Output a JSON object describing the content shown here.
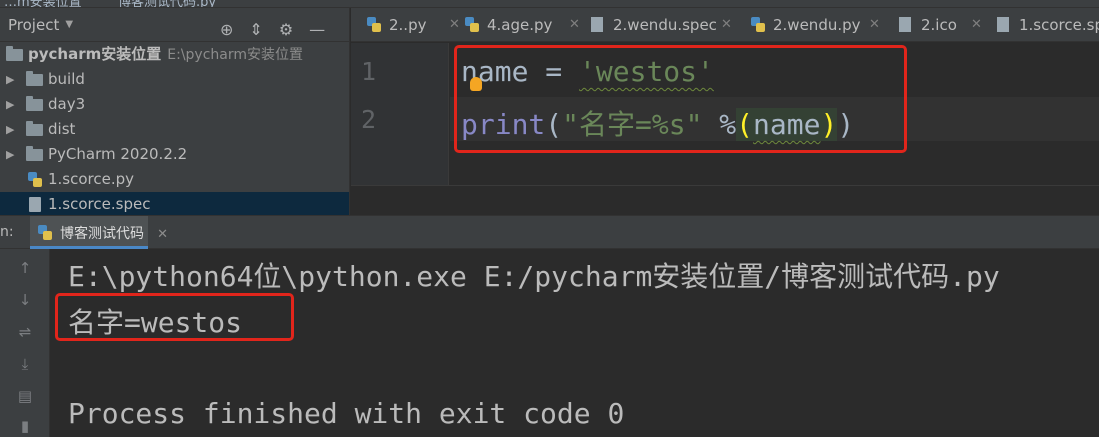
{
  "breadcrumb": {
    "left": "…m安装位置",
    "right": "博客测试代码.py"
  },
  "project_panel": {
    "title": "Project",
    "tree": [
      {
        "label": "pycharm安装位置",
        "path": "E:\\pycharm安装位置",
        "type": "root"
      },
      {
        "label": "build",
        "type": "folder"
      },
      {
        "label": "day3",
        "type": "folder"
      },
      {
        "label": "dist",
        "type": "folder"
      },
      {
        "label": "PyCharm 2020.2.2",
        "type": "folder"
      },
      {
        "label": "1.scorce.py",
        "type": "py"
      },
      {
        "label": "1.scorce.spec",
        "type": "spec"
      }
    ]
  },
  "editor_tabs": [
    {
      "label": "2..py",
      "icon": "python-file-icon"
    },
    {
      "label": "4.age.py",
      "icon": "python-file-icon"
    },
    {
      "label": "2.wendu.spec",
      "icon": "file-icon"
    },
    {
      "label": "2.wendu.py",
      "icon": "python-file-icon"
    },
    {
      "label": "2.ico",
      "icon": "file-icon"
    },
    {
      "label": "1.scorce.sp",
      "icon": "file-icon"
    }
  ],
  "editor": {
    "line_numbers": [
      "1",
      "2"
    ],
    "line1": {
      "var": "name",
      "op": " = ",
      "str": "'westos'"
    },
    "line2": {
      "fn": "print",
      "open": "(",
      "str": "\"名字=%s\"",
      "op": " %",
      "lparen": "(",
      "arg": "name",
      "rparen": ")",
      "close": ")"
    }
  },
  "run_panel": {
    "label": "n:",
    "tab_label": "博客测试代码",
    "output": [
      "E:\\python64位\\python.exe E:/pycharm安装位置/博客测试代码.py",
      "名字=westos",
      "",
      "Process finished with exit code 0"
    ]
  },
  "colors": {
    "highlight_box": "#e1251b",
    "string": "#6a8759",
    "builtin": "#8888c6",
    "brace_match": "#ffef28"
  }
}
